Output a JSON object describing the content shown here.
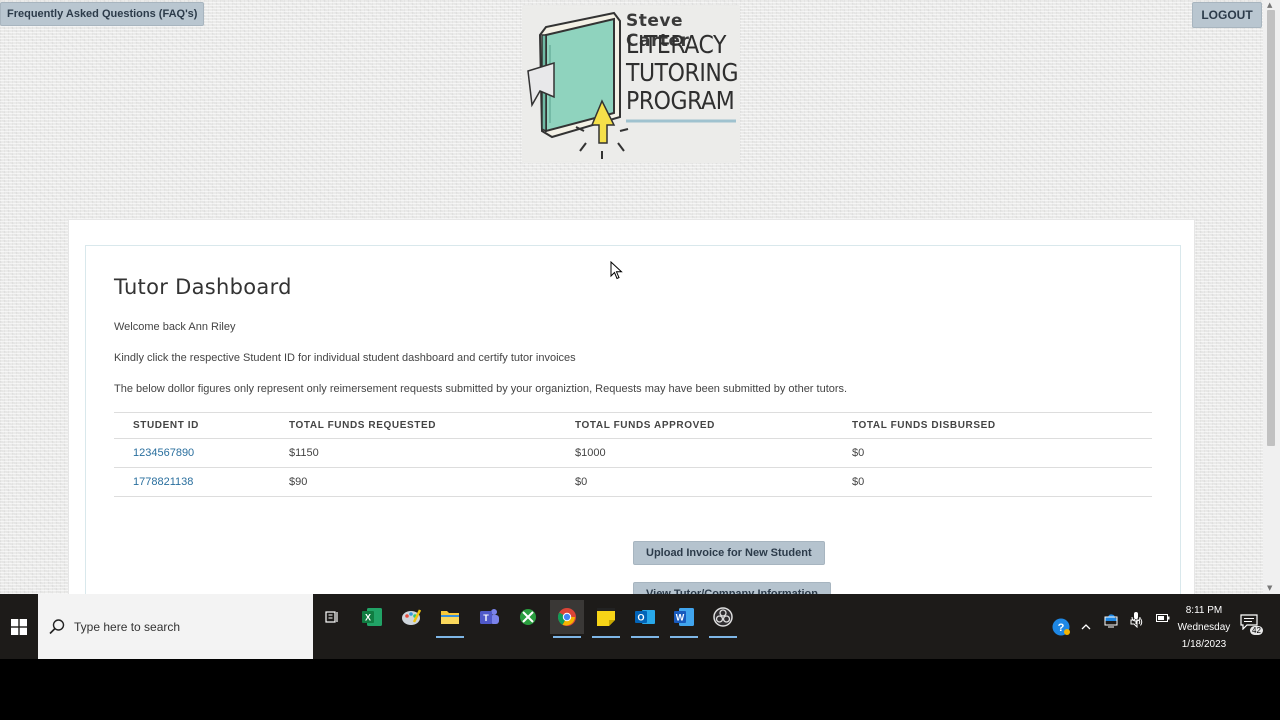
{
  "header": {
    "faq_label": "Frequently Asked Questions (FAQ's)",
    "logout_label": "LOGOUT"
  },
  "logo": {
    "line1": "Steve Carter",
    "line2": "LITERACY",
    "line3": "TUTORING",
    "line4": "PROGRAM"
  },
  "dashboard": {
    "title": "Tutor Dashboard",
    "welcome": "Welcome back Ann Riley",
    "instruction": "Kindly click the respective Student ID for individual student dashboard and certify tutor invoices",
    "note": "The below dollor figures only represent only reimersement requests submitted by your organiztion, Requests may have been submitted by other tutors.",
    "columns": [
      "STUDENT ID",
      "TOTAL FUNDS REQUESTED",
      "TOTAL FUNDS APPROVED",
      "TOTAL FUNDS DISBURSED"
    ],
    "rows": [
      {
        "student_id": "1234567890",
        "requested": "$1150",
        "approved": "$1000",
        "disbursed": "$0"
      },
      {
        "student_id": "1778821138",
        "requested": "$90",
        "approved": "$0",
        "disbursed": "$0"
      }
    ],
    "upload_button": "Upload Invoice for New Student",
    "view_button": "View Tutor/Company Information"
  },
  "taskbar": {
    "search_placeholder": "Type here to search",
    "time": "8:11 PM",
    "day": "Wednesday",
    "date": "1/18/2023",
    "notification_count": "42",
    "pinned_apps": [
      "excel-icon",
      "paint-icon",
      "file-explorer-icon",
      "teams-icon",
      "xbox-icon",
      "chrome-icon",
      "sticky-notes-icon",
      "outlook-icon",
      "word-icon",
      "obs-icon"
    ]
  },
  "colors": {
    "link": "#2a6f9e",
    "button": "#b5c3ce",
    "taskbar": "#1d1b19"
  }
}
